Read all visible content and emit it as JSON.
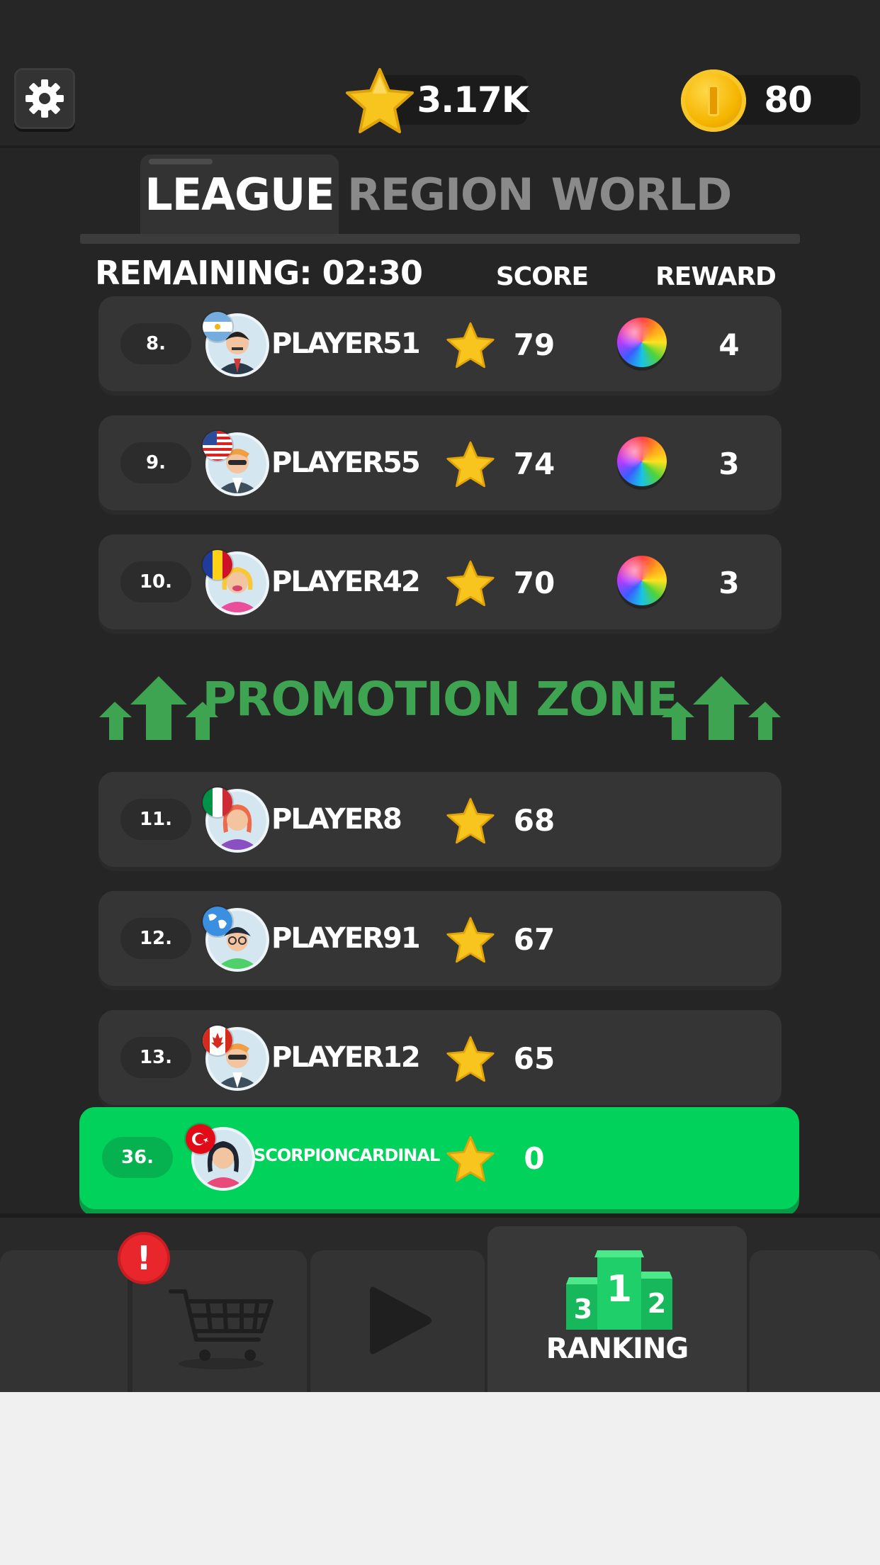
{
  "header": {
    "stars": "3.17K",
    "coins": "80"
  },
  "tabs": [
    {
      "label": "LEAGUE",
      "active": true
    },
    {
      "label": "REGION",
      "active": false
    },
    {
      "label": "WORLD",
      "active": false
    }
  ],
  "table": {
    "remaining": "REMAINING: 02:30",
    "score_header": "SCORE",
    "reward_header": "REWARD"
  },
  "rows": [
    {
      "rank": "8.",
      "name": "PLAYER51",
      "score": "79",
      "reward": "4",
      "flag": "argentina"
    },
    {
      "rank": "9.",
      "name": "PLAYER55",
      "score": "74",
      "reward": "3",
      "flag": "usa"
    },
    {
      "rank": "10.",
      "name": "PLAYER42",
      "score": "70",
      "reward": "3",
      "flag": "romania"
    },
    {
      "rank": "11.",
      "name": "PLAYER8",
      "score": "68",
      "flag": "italy"
    },
    {
      "rank": "12.",
      "name": "PLAYER91",
      "score": "67",
      "flag": "globe"
    },
    {
      "rank": "13.",
      "name": "PLAYER12",
      "score": "65",
      "flag": "canada"
    }
  ],
  "promotion_zone": "PROMOTION ZONE",
  "me": {
    "rank": "36.",
    "name": "SCORPIONCARDINAL",
    "score": "0",
    "flag": "turkey"
  },
  "nav": {
    "shop_alert": "!",
    "ranking_label": "RANKING",
    "podium": {
      "first": "1",
      "second": "2",
      "third": "3"
    }
  },
  "colors": {
    "promotion_green": "#3fa451",
    "me_row_green": "#00d25c",
    "podium_green": "#1fcf6a"
  }
}
